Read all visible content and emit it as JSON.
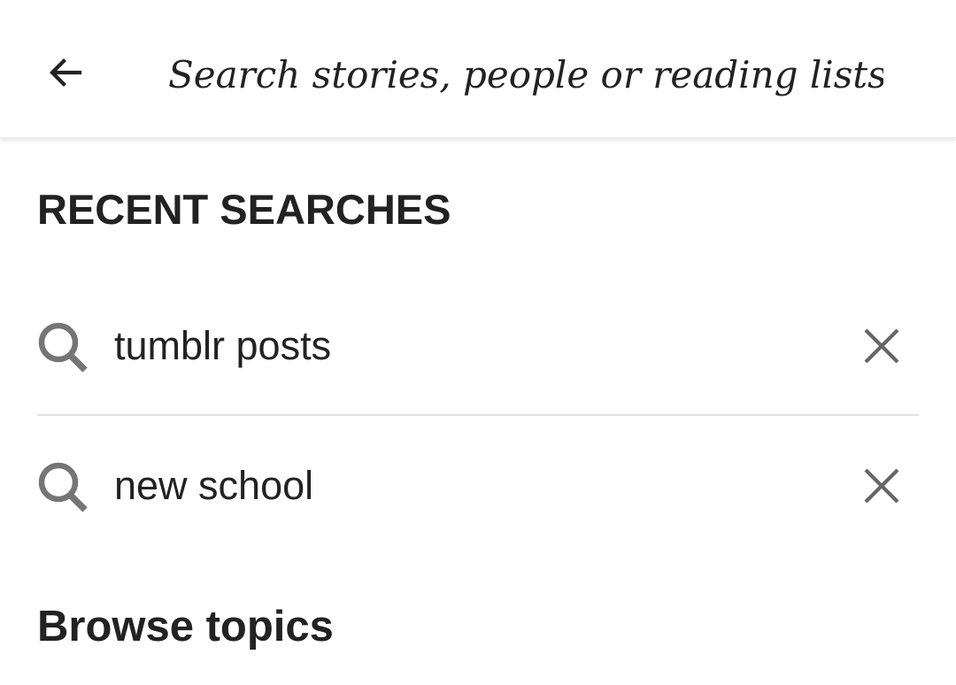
{
  "header": {
    "back_icon": "arrow-left-icon",
    "search_placeholder": "Search stories, people or reading lists"
  },
  "recent_searches": {
    "title": "RECENT SEARCHES",
    "items": [
      {
        "label": "tumblr posts",
        "icon": "search-icon",
        "remove_icon": "close-icon"
      },
      {
        "label": "new school",
        "icon": "search-icon",
        "remove_icon": "close-icon"
      }
    ]
  },
  "browse": {
    "title": "Browse topics"
  },
  "colors": {
    "text": "#222222",
    "icon": "#757575",
    "divider": "#e3e3e3",
    "background": "#ffffff"
  }
}
